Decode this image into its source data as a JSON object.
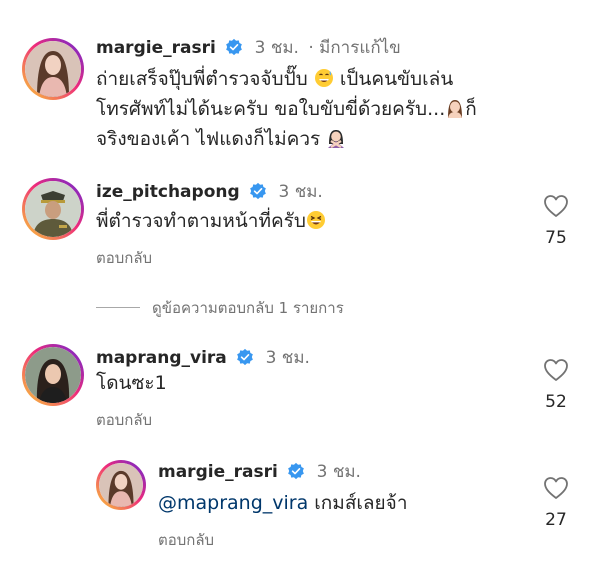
{
  "verified_color": "#3897f0",
  "accent_link_color": "#00376b",
  "comments": [
    {
      "username": "margie_rasri",
      "verified": true,
      "time": "3 ชม.",
      "edited": "· มีการแก้ไข",
      "avatar": "woman-avatar",
      "lines": [
        "ถ่ายเสร็จปุ๊บพี่ตำรวจจับปั๊บ",
        "เป็นคนขับเล่น",
        "โทรศัพท์ไม่ได้นะครับ ขอใบขับขี่ด้วยครับ...",
        "ก็",
        "จริงของเค้า ไฟแดงก็ไม่ควร"
      ],
      "emojis": [
        "grinning-sweat-emoji",
        "woman-emoji",
        "woman-gesturing-no-emoji"
      ]
    },
    {
      "username": "ize_pitchapong",
      "verified": true,
      "time": "3 ชม.",
      "avatar": "police-officer-avatar",
      "text": "พี่ตำรวจทำตามหน้าที่ครับ",
      "emoji": "laughing-emoji",
      "reply_label": "ตอบกลับ",
      "likes": "75"
    },
    {
      "username": "maprang_vira",
      "verified": true,
      "time": "3 ชม.",
      "avatar": "woman-avatar",
      "text": "โดนซะ1",
      "reply_label": "ตอบกลับ",
      "likes": "52"
    },
    {
      "username": "margie_rasri",
      "verified": true,
      "time": "3 ชม.",
      "avatar": "woman-avatar",
      "mention": "@maprang_vira",
      "text": "เกมส์เลยจ้า",
      "reply_label": "ตอบกลับ",
      "likes": "27"
    }
  ],
  "view_replies": "ดูข้อความตอบกลับ 1 รายการ"
}
